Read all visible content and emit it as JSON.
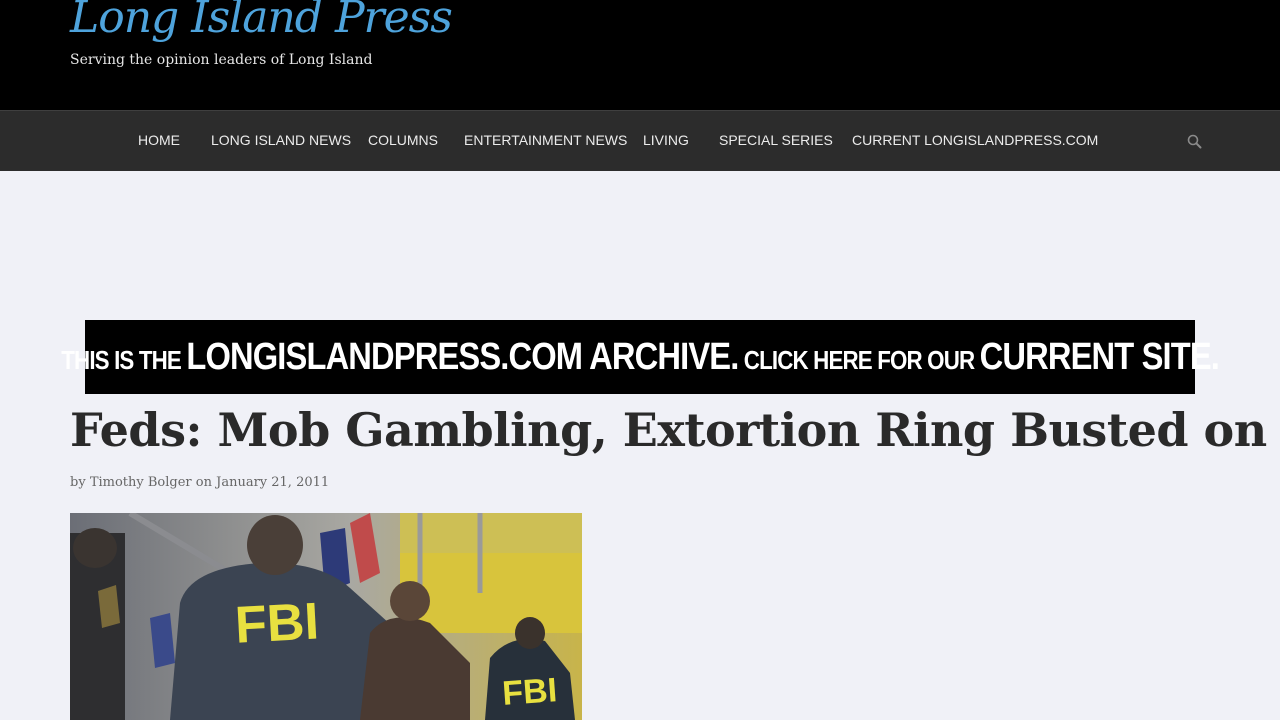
{
  "header": {
    "logo_title": "Long Island Press",
    "tagline": "Serving the opinion leaders of Long Island"
  },
  "nav": {
    "items": [
      {
        "label": "HOME"
      },
      {
        "label": "LONG ISLAND NEWS"
      },
      {
        "label": "COLUMNS"
      },
      {
        "label": "ENTERTAINMENT NEWS"
      },
      {
        "label": "LIVING"
      },
      {
        "label": "SPECIAL SERIES"
      },
      {
        "label": "CURRENT LONGISLANDPRESS.COM"
      }
    ],
    "search_icon": "search-icon"
  },
  "banner": {
    "part1": "THIS IS THE ",
    "part2": "LONGISLANDPRESS.COM ARCHIVE.",
    "part3": " CLICK HERE FOR OUR ",
    "part4": "CURRENT SITE."
  },
  "article": {
    "title": "Feds: Mob Gambling, Extortion Ring Busted on LI",
    "byline_prefix": "by ",
    "author": "Timothy Bolger",
    "date_prefix": " on ",
    "date": "January 21, 2011",
    "image_text_main": "FBI",
    "image_text_secondary": "FBI"
  },
  "colors": {
    "logo_blue": "#4ea3dc",
    "header_bg": "#000000",
    "nav_bg": "#2c2c2c",
    "page_bg": "#f0f1f7",
    "fbi_yellow": "#e8e040"
  }
}
